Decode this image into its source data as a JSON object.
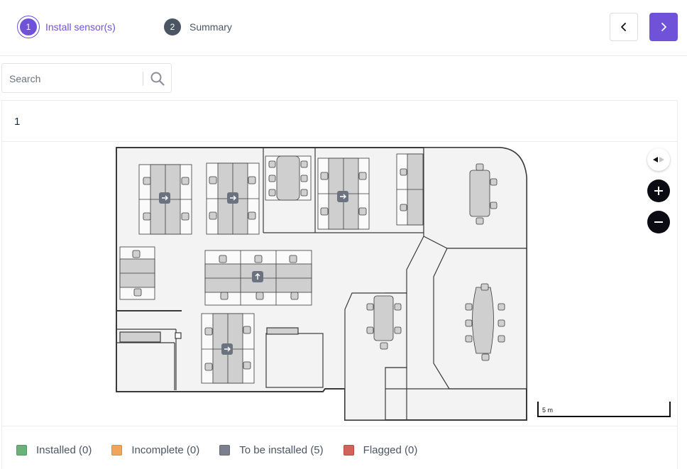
{
  "stepper": {
    "steps": [
      {
        "number": "1",
        "label": "Install sensor(s)",
        "state": "active"
      },
      {
        "number": "2",
        "label": "Summary",
        "state": "pending"
      }
    ]
  },
  "nav": {
    "prev_icon": "chevron-left-icon",
    "next_icon": "chevron-right-icon"
  },
  "search": {
    "placeholder": "Search",
    "value": ""
  },
  "floor": {
    "title": "1"
  },
  "map_controls": {
    "compass": "compass-icon",
    "zoom_in": "plus-icon",
    "zoom_out": "minus-icon"
  },
  "scale": {
    "label": "5 m"
  },
  "legend": {
    "items": [
      {
        "label": "Installed (0)",
        "color": "#6ab27a"
      },
      {
        "label": "Incomplete (0)",
        "color": "#f2a55a"
      },
      {
        "label": "To be installed (5)",
        "color": "#7b7f8e"
      },
      {
        "label": "Flagged (0)",
        "color": "#d2635b"
      }
    ]
  },
  "colors": {
    "accent": "#6f52d8",
    "marker": "#6b7280"
  }
}
